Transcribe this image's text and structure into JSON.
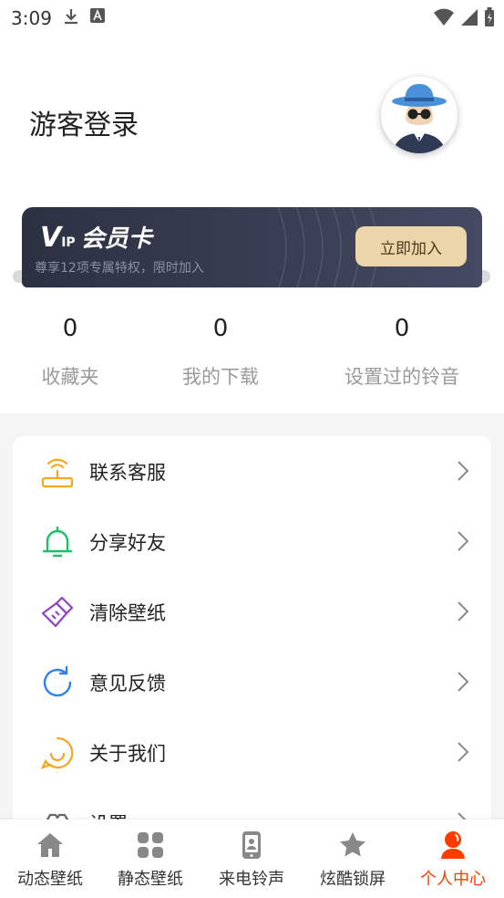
{
  "status_bar": {
    "time": "3:09"
  },
  "profile": {
    "guest_login": "游客登录"
  },
  "vip": {
    "title": "会员卡",
    "logo_v": "V",
    "logo_ip": "IP",
    "description": "尊享12项专属特权，限时加入",
    "join_button": "立即加入"
  },
  "stats": [
    {
      "count": "0",
      "label": "收藏夹"
    },
    {
      "count": "0",
      "label": "我的下载"
    },
    {
      "count": "0",
      "label": "设置过的铃音"
    }
  ],
  "menu": [
    {
      "label": "联系客服",
      "icon": "router-icon"
    },
    {
      "label": "分享好友",
      "icon": "bell-icon"
    },
    {
      "label": "清除壁纸",
      "icon": "brush-icon"
    },
    {
      "label": "意见反馈",
      "icon": "refresh-icon"
    },
    {
      "label": "关于我们",
      "icon": "smile-bubble-icon"
    },
    {
      "label": "设置",
      "icon": "settings-icon"
    }
  ],
  "nav": [
    {
      "label": "动态壁纸",
      "icon": "home-icon"
    },
    {
      "label": "静态壁纸",
      "icon": "grid-icon"
    },
    {
      "label": "来电铃声",
      "icon": "phone-icon"
    },
    {
      "label": "炫酷锁屏",
      "icon": "star-icon"
    },
    {
      "label": "个人中心",
      "icon": "person-icon",
      "active": true
    }
  ],
  "colors": {
    "accent": "#ff3b00",
    "vip_bg": "#2c3142",
    "vip_button": "#ecd5a9"
  }
}
